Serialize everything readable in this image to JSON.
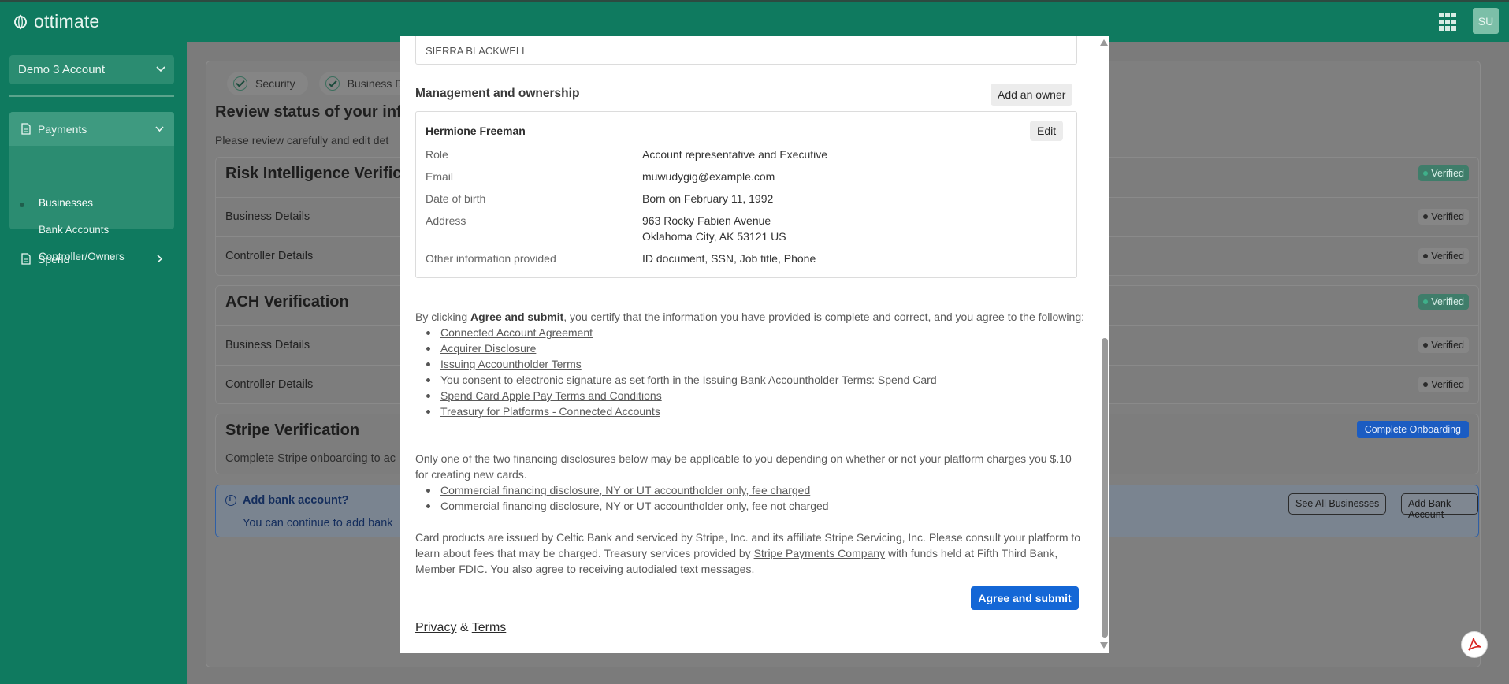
{
  "app": {
    "logo_text": "ottimate",
    "avatar_initials": "SU"
  },
  "sidebar": {
    "account_selector": "Demo 3 Account",
    "payments_label": "Payments",
    "payments_items": [
      "Businesses",
      "Bank Accounts",
      "Controller/Owners"
    ],
    "spend_label": "Spend"
  },
  "main": {
    "steps": [
      "Security",
      "Business De"
    ],
    "review_title": "Review status of your inf",
    "review_sub": "Please review carefully and edit det",
    "risk": {
      "title": "Risk Intelligence Verific",
      "status": "Verified",
      "rows": [
        {
          "label": "Business Details",
          "status": "Verified"
        },
        {
          "label": "Controller Details",
          "status": "Verified"
        }
      ]
    },
    "ach": {
      "title": "ACH Verification",
      "status": "Verified",
      "rows": [
        {
          "label": "Business Details",
          "status": "Verified"
        },
        {
          "label": "Controller Details",
          "status": "Verified"
        }
      ]
    },
    "stripe": {
      "title": "Stripe Verification",
      "desc": "Complete Stripe onboarding to ac",
      "button": "Complete Onboarding"
    },
    "bank": {
      "title": "Add bank account?",
      "desc": "You can continue to add bank",
      "see_all": "See All Businesses",
      "add": "Add Bank Account"
    }
  },
  "modal": {
    "name_value": "SIERRA BLACKWELL",
    "mgmt_title": "Management and ownership",
    "add_owner": "Add an owner",
    "owner": {
      "name": "Hermione Freeman",
      "edit": "Edit",
      "fields": [
        {
          "label": "Role",
          "value": "Account representative and Executive"
        },
        {
          "label": "Email",
          "value": "muwudygig@example.com"
        },
        {
          "label": "Date of birth",
          "value": "Born on February 11, 1992"
        },
        {
          "label": "Address",
          "value": "963 Rocky Fabien Avenue",
          "value2": "Oklahoma City, AK 53121 US"
        },
        {
          "label": "Other information provided",
          "value": "ID document, SSN, Job title, Phone"
        }
      ]
    },
    "legal": {
      "p1_pre": "By clicking ",
      "p1_bold": "Agree and submit",
      "p1_post": ", you certify that the information you have provided is complete and correct, and you agree to the following:",
      "links": [
        "Connected Account Agreement",
        "Acquirer Disclosure",
        "Issuing Accountholder Terms"
      ],
      "consent_pre": "You consent to electronic signature as set forth in the ",
      "consent_link": "Issuing Bank Accountholder Terms: Spend Card",
      "links2": [
        "Spend Card Apple Pay Terms and Conditions",
        "Treasury for Platforms - Connected Accounts"
      ],
      "p2": "Only one of the two financing disclosures below may be applicable to you depending on whether or not your platform charges you $.10 for creating new cards.",
      "links3": [
        "Commercial financing disclosure, NY or UT accountholder only, fee charged",
        "Commercial financing disclosure, NY or UT accountholder only, fee not charged"
      ],
      "p3_pre": "Card products are issued by Celtic Bank and serviced by Stripe, Inc. and its affiliate Stripe Servicing, Inc. Please consult your platform to learn about fees that may be charged. Treasury services provided by ",
      "p3_link": "Stripe Payments Company",
      "p3_post": " with funds held at Fifth Third Bank, Member FDIC. You also agree to receiving autodialed text messages."
    },
    "agree_button": "Agree and submit",
    "footer": {
      "privacy": "Privacy",
      "amp": "&",
      "terms": "Terms"
    }
  }
}
